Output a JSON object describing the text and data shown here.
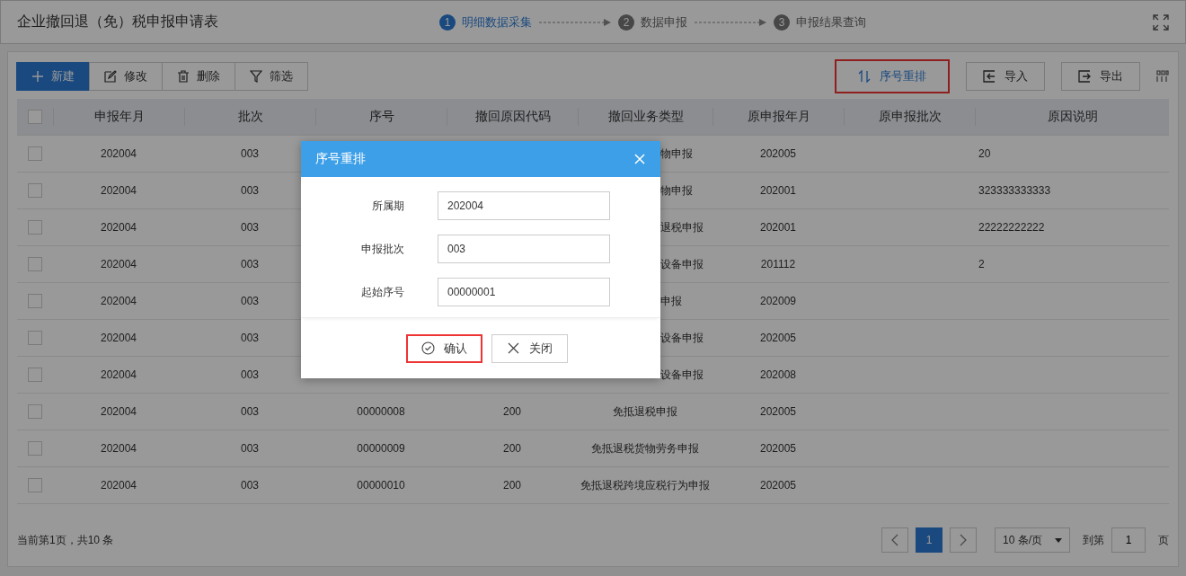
{
  "title": "企业撤回退（免）税申报申请表",
  "steps": [
    {
      "number": "1",
      "label": "明细数据采集",
      "selected": true
    },
    {
      "number": "2",
      "label": "数据申报",
      "selected": false
    },
    {
      "number": "3",
      "label": "申报结果查询",
      "selected": false
    }
  ],
  "toolbar_left": [
    {
      "kind": "add",
      "label": "新建",
      "primary": true
    },
    {
      "kind": "edit",
      "label": "修改",
      "primary": false
    },
    {
      "kind": "delete",
      "label": "删除",
      "primary": false
    },
    {
      "kind": "filter",
      "label": "筛选",
      "primary": false
    }
  ],
  "toolbar_right": [
    {
      "kind": "sort",
      "label": "序号重排",
      "highlighted": true
    },
    {
      "kind": "import",
      "label": "导入",
      "highlighted": false
    },
    {
      "kind": "export",
      "label": "导出",
      "highlighted": false
    }
  ],
  "table": {
    "header_checked": false,
    "columns": [
      "申报年月",
      "批次",
      "序号",
      "撤回原因代码",
      "撤回业务类型",
      "原申报年月",
      "原申报批次",
      "原因说明"
    ],
    "rows": [
      {
        "checked": false,
        "period": "202004",
        "batch": "003",
        "type": "物申报",
        "orig_period": "202005",
        "reason": "20"
      },
      {
        "checked": false,
        "period": "202004",
        "batch": "003",
        "type": "物申报",
        "orig_period": "202001",
        "reason": "323333333333"
      },
      {
        "checked": false,
        "period": "202004",
        "batch": "003",
        "type": "退税申报",
        "orig_period": "202001",
        "reason": "22222222222"
      },
      {
        "checked": false,
        "period": "202004",
        "batch": "003",
        "type": "设备申报",
        "orig_period": "201112",
        "reason": "2"
      },
      {
        "checked": false,
        "period": "202004",
        "batch": "003",
        "type": "申报",
        "orig_period": "202009"
      },
      {
        "checked": false,
        "period": "202004",
        "batch": "003",
        "type": "设备申报",
        "orig_period": "202005"
      },
      {
        "checked": false,
        "period": "202004",
        "batch": "003",
        "type": "设备申报",
        "orig_period": "202008"
      },
      {
        "checked": false,
        "period": "202004",
        "batch": "003",
        "seq": "00000008",
        "code": "200",
        "type": "免抵退税申报",
        "orig_period": "202005"
      },
      {
        "checked": false,
        "period": "202004",
        "batch": "003",
        "seq": "00000009",
        "code": "200",
        "type": "免抵退税货物劳务申报",
        "orig_period": "202005"
      },
      {
        "checked": false,
        "period": "202004",
        "batch": "003",
        "seq": "00000010",
        "code": "200",
        "type": "免抵退税跨境应税行为申报",
        "orig_period": "202005"
      }
    ]
  },
  "pagination": {
    "summary": "当前第1页，共10 条",
    "pages": [
      {
        "label": "1",
        "selected": true
      }
    ],
    "page_size": "10 条/页",
    "goto_label": "到第",
    "goto_value": "1",
    "goto_suffix": "页"
  },
  "dialog": {
    "title": "序号重排",
    "fields": [
      {
        "label": "所属期",
        "value": "202004"
      },
      {
        "label": "申报批次",
        "value": "003"
      },
      {
        "label": "起始序号",
        "value": "00000001"
      }
    ],
    "buttons": [
      {
        "kind": "confirm",
        "label": "确认",
        "highlighted": true
      },
      {
        "kind": "close",
        "label": "关闭",
        "highlighted": false
      }
    ]
  }
}
